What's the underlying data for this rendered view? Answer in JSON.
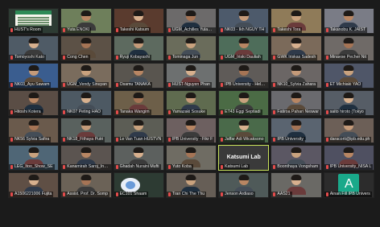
{
  "participants": [
    {
      "name": "HUST's Room",
      "style": "poster"
    },
    {
      "name": "Yuta ENOKI",
      "bg": "#6e7f5b"
    },
    {
      "name": "Takeshi Katsum",
      "bg": "#5a3b2e"
    },
    {
      "name": "UGM_Achilles Yulanda",
      "bg": "#6c6a6a"
    },
    {
      "name": "NK03 - Ikh NGUY TH",
      "bg": "#4d5a6b"
    },
    {
      "name": "Takeshi Tora",
      "bg": "#8f7b59"
    },
    {
      "name": "Takanobu K. JAIST",
      "bg": "#7a7c86"
    },
    {
      "name": "Tomoyoshi Kato",
      "bg": "#4f5b66"
    },
    {
      "name": "Cong Chen",
      "bg": "#5c5146"
    },
    {
      "name": "Ryuji Kobayashi",
      "bg": "#5d6a5f"
    },
    {
      "name": "Tominaga Jun",
      "bg": "#6a6c5b"
    },
    {
      "name": "UGM_Iriski Dauliah",
      "bg": "#4e6d5a"
    },
    {
      "name": "GWK Iriskas Sadesh",
      "bg": "#7b6a5a"
    },
    {
      "name": "Minaese Pecher Nit",
      "bg": "#6f6a67"
    },
    {
      "name": "NK03_Ayu Sawam",
      "bg": "#3a5d8f"
    },
    {
      "name": "UGM_Vendy Sinuyan",
      "bg": "#7a6c5d"
    },
    {
      "name": "Osamu TANAKA",
      "bg": "#59554f"
    },
    {
      "name": "HUST-Nguyen Phan",
      "bg": "#6d7070"
    },
    {
      "name": "IPB University - Hely M.",
      "bg": "#5f5b58"
    },
    {
      "name": "NK10_Sylvia Zahara",
      "bg": "#6b6665"
    },
    {
      "name": "ET Michiaki YAO",
      "bg": "#4f5668"
    },
    {
      "name": "Hitoshi Kotera",
      "bg": "#5a4d45"
    },
    {
      "name": "NK07 Peting HAO",
      "bg": "#4d5963"
    },
    {
      "name": "Tanaka Wangim",
      "bg": "#6d5f49"
    },
    {
      "name": "Yamazaki Sosuke",
      "bg": "#5f6b4f"
    },
    {
      "name": "ET43 Eggi Septiadi",
      "bg": "#4b6b45"
    },
    {
      "name": "Fatiroa Pahari Neswar",
      "bg": "#6a6a6e"
    },
    {
      "name": "saito hiroto (Tokyo",
      "bg": "#565d66"
    },
    {
      "name": "NK56 Sylvia Safira",
      "bg": "#6a5a4c"
    },
    {
      "name": "NK18_Fithaya Putri",
      "bg": "#59615e"
    },
    {
      "name": "Le Van Tuan HUSTVN",
      "bg": "#5c5d55"
    },
    {
      "name": "IPB University - Fikr F",
      "bg": "#6d6060"
    },
    {
      "name": "Jaffar Adi Wicaksono",
      "bg": "#4a6a4a"
    },
    {
      "name": "IPB University",
      "bg": "#5a6470"
    },
    {
      "name": "daracorti@ipb.edu.ph",
      "bg": "#6c5f57"
    },
    {
      "name": "LEG_Itoo_Show_SE",
      "bg": "#4f6676"
    },
    {
      "name": "Kanamirah Saroj_Indea",
      "bg": "#5b5450"
    },
    {
      "name": "Ghadah Nuraini Mufti",
      "bg": "#5c605e"
    },
    {
      "name": "Yuto Koba",
      "bg": "#6f6c63"
    },
    {
      "name": "Katsumi Lab",
      "style": "label",
      "label": "Katsumi Lab"
    },
    {
      "name": "Boonthaya Vongsham",
      "bg": "#5b5763"
    },
    {
      "name": "IPB University_NISA L",
      "bg": "#4f5061"
    },
    {
      "name": "A1506221006 Fujita",
      "bg": "#5f4f45"
    },
    {
      "name": "Assist. Prof. Dr. Somp",
      "bg": "#6b6257"
    },
    {
      "name": "EC101 Shaam",
      "style": "logo"
    },
    {
      "name": "Tran Chi The Thu",
      "bg": "#665e56"
    },
    {
      "name": "Jenson Ardiaso",
      "bg": "#4f5a59"
    },
    {
      "name": "AAS21",
      "bg": "#6a6965"
    },
    {
      "name": "Ainan Fill IPB Univers",
      "style": "avatar",
      "initial": "A"
    }
  ]
}
